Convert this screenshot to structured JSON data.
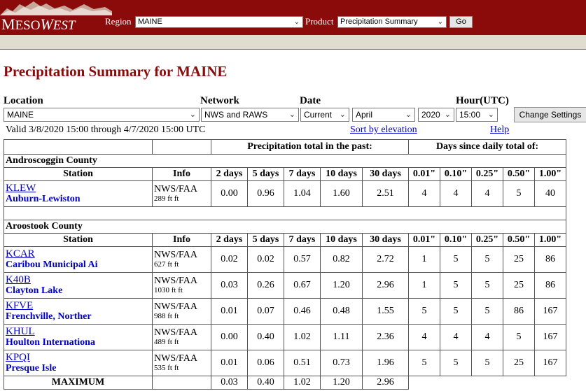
{
  "header": {
    "logo_text_1": "M",
    "logo_text_2": "ESO",
    "logo_text_3": "W",
    "logo_text_4": "EST",
    "region_label": "Region",
    "region_value": "MAINE",
    "product_label": "Product",
    "product_value": "Precipitation Summary",
    "go_label": "Go"
  },
  "page_title": "Precipitation Summary for MAINE",
  "filters": {
    "location_label": "Location",
    "location_value": "MAINE",
    "network_label": "Network",
    "network_value": "NWS and RAWS",
    "date_label": "Date",
    "date_value": "Current",
    "month_value": "April",
    "year_value": "2020",
    "hour_label": "Hour(UTC)",
    "hour_value": "15:00",
    "change_label": "Change Settings"
  },
  "valid_text": "Valid 3/8/2020 15:00 through 4/7/2020 15:00 UTC",
  "sort_link": "Sort by elevation",
  "help_link": "Help",
  "table": {
    "precip_group": "Precipitation total in the past:",
    "days_group": "Days since daily total of:",
    "station_header": "Station",
    "info_header": "Info",
    "precip_cols": [
      "2 days",
      "5 days",
      "7 days",
      "10 days",
      "30 days"
    ],
    "days_cols": [
      "0.01\"",
      "0.10\"",
      "0.25\"",
      "0.50\"",
      "1.00\""
    ],
    "counties": [
      {
        "name": "Androscoggin County",
        "stations": [
          {
            "id": "KLEW",
            "name": "Auburn-Lewiston",
            "network": "NWS/FAA",
            "elev": "289 ft ft",
            "precip": [
              "0.00",
              "0.96",
              "1.04",
              "1.60",
              "2.51"
            ],
            "days": [
              "4",
              "4",
              "4",
              "5",
              "40"
            ]
          }
        ]
      },
      {
        "name": "Aroostook County",
        "stations": [
          {
            "id": "KCAR",
            "name": "Caribou Municipal Ai",
            "network": "NWS/FAA",
            "elev": "627 ft ft",
            "precip": [
              "0.02",
              "0.02",
              "0.57",
              "0.82",
              "2.72"
            ],
            "days": [
              "1",
              "5",
              "5",
              "25",
              "86"
            ]
          },
          {
            "id": "K40B",
            "name": "Clayton Lake",
            "network": "NWS/FAA",
            "elev": "1030 ft ft",
            "precip": [
              "0.03",
              "0.26",
              "0.67",
              "1.20",
              "2.96"
            ],
            "days": [
              "1",
              "5",
              "5",
              "25",
              "86"
            ]
          },
          {
            "id": "KFVE",
            "name": "Frenchville, Norther",
            "network": "NWS/FAA",
            "elev": "988 ft ft",
            "precip": [
              "0.01",
              "0.07",
              "0.46",
              "0.48",
              "1.55"
            ],
            "days": [
              "5",
              "5",
              "5",
              "86",
              "167"
            ]
          },
          {
            "id": "KHUL",
            "name": "Houlton Internationa",
            "network": "NWS/FAA",
            "elev": "489 ft ft",
            "precip": [
              "0.00",
              "0.40",
              "1.02",
              "1.11",
              "2.36"
            ],
            "days": [
              "4",
              "4",
              "4",
              "5",
              "167"
            ]
          },
          {
            "id": "KPQI",
            "name": "Presque Isle",
            "network": "NWS/FAA",
            "elev": "535 ft ft",
            "precip": [
              "0.01",
              "0.06",
              "0.51",
              "0.73",
              "1.96"
            ],
            "days": [
              "5",
              "5",
              "5",
              "25",
              "167"
            ]
          }
        ]
      }
    ],
    "maximum_label": "MAXIMUM",
    "maximum_values": [
      "0.03",
      "0.40",
      "1.02",
      "1.20",
      "2.96"
    ]
  }
}
